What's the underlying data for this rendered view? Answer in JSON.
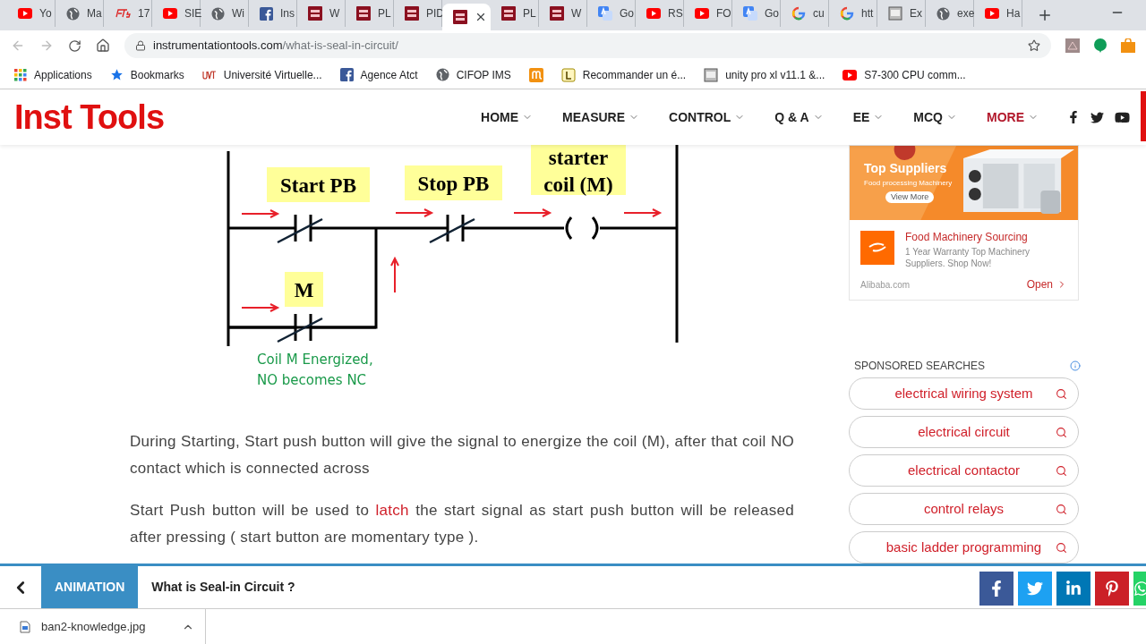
{
  "browser": {
    "tabs": [
      {
        "kind": "youtube",
        "label": "Yo",
        "selected": false
      },
      {
        "kind": "globe",
        "label": "Ma",
        "selected": false
      },
      {
        "kind": "ets",
        "label": "17",
        "selected": false
      },
      {
        "kind": "youtube",
        "label": "SIE",
        "selected": false
      },
      {
        "kind": "globe",
        "label": "Wi",
        "selected": false
      },
      {
        "kind": "facebook",
        "label": "Ins",
        "selected": false
      },
      {
        "kind": "site",
        "label": "W",
        "selected": false
      },
      {
        "kind": "site",
        "label": "PL",
        "selected": false
      },
      {
        "kind": "site",
        "label": "PID",
        "selected": false
      },
      {
        "kind": "site",
        "selected": true
      },
      {
        "kind": "site",
        "label": "PL",
        "selected": false
      },
      {
        "kind": "site",
        "label": "W",
        "selected": false
      },
      {
        "kind": "translate",
        "label": "Go",
        "selected": false
      },
      {
        "kind": "youtube",
        "label": "RS",
        "selected": false
      },
      {
        "kind": "youtube",
        "label": "FO",
        "selected": false
      },
      {
        "kind": "translate",
        "label": "Go",
        "selected": false
      },
      {
        "kind": "google",
        "label": "cu",
        "selected": false
      },
      {
        "kind": "google",
        "label": "htt",
        "selected": false
      },
      {
        "label": "Ex",
        "selected": false
      },
      {
        "kind": "globe",
        "label": "exe",
        "selected": false
      },
      {
        "kind": "youtube",
        "label": "Ha",
        "selected": false
      }
    ],
    "address": {
      "domain": "instrumentationtools.com",
      "path": "/what-is-seal-in-circuit/"
    },
    "bookmarks": [
      {
        "kind": "apps",
        "label": "Applications"
      },
      {
        "kind": "star",
        "label": "Bookmarks"
      },
      {
        "kind": "uvt",
        "label": "Université Virtuelle..."
      },
      {
        "kind": "facebook",
        "label": "Agence Atct"
      },
      {
        "kind": "globe",
        "label": "CIFOP IMS"
      },
      {
        "kind": "orange"
      },
      {
        "kind": "letter",
        "label": "Recommander un é..."
      },
      {
        "label": "unity pro xl v11.1 &..."
      },
      {
        "kind": "youtube",
        "label": "S7-300 CPU comm..."
      }
    ]
  },
  "site": {
    "logo": "Inst Tools",
    "nav": [
      {
        "label": "HOME",
        "selected": false
      },
      {
        "label": "MEASURE",
        "selected": false
      },
      {
        "label": "CONTROL",
        "selected": false
      },
      {
        "label": "Q & A",
        "selected": false
      },
      {
        "label": "EE",
        "selected": false
      },
      {
        "label": "MCQ",
        "selected": false
      },
      {
        "label": "MORE",
        "selected": true
      }
    ]
  },
  "diagram": {
    "start": "Start PB",
    "stop": "Stop PB",
    "coil": [
      "starter",
      "coil (M)"
    ],
    "hold": "M",
    "note": [
      "Coil M Energized,",
      "NO becomes NC"
    ]
  },
  "article": {
    "paragraphs": [
      {
        "before": "During Starting, Start push button will give the signal to energize the coil (M), after that coil NO contact which is connected across"
      },
      {
        "before": "Start Push button will be used to ",
        "link": "latch",
        "after": " the start signal as start push button will be released after pressing ( start button are momentary type )."
      }
    ]
  },
  "ad": {
    "headline": "Top Suppliers",
    "subline": "Food processing Machinery",
    "banner_button": "View More",
    "title": "Food Machinery Sourcing",
    "text": "1 Year Warranty Top Machinery Suppliers. Shop Now!",
    "source": "Alibaba.com",
    "action": "Open"
  },
  "sponsored": {
    "title": "SPONSORED SEARCHES",
    "items": [
      "electrical wiring system",
      "electrical circuit",
      "electrical contactor",
      "control relays",
      "basic ladder programming"
    ]
  },
  "sticky_bar": {
    "category": "ANIMATION",
    "title": "What is Seal-in Circuit ?"
  },
  "downloads": [
    {
      "name": "ban2-knowledge.jpg"
    }
  ]
}
